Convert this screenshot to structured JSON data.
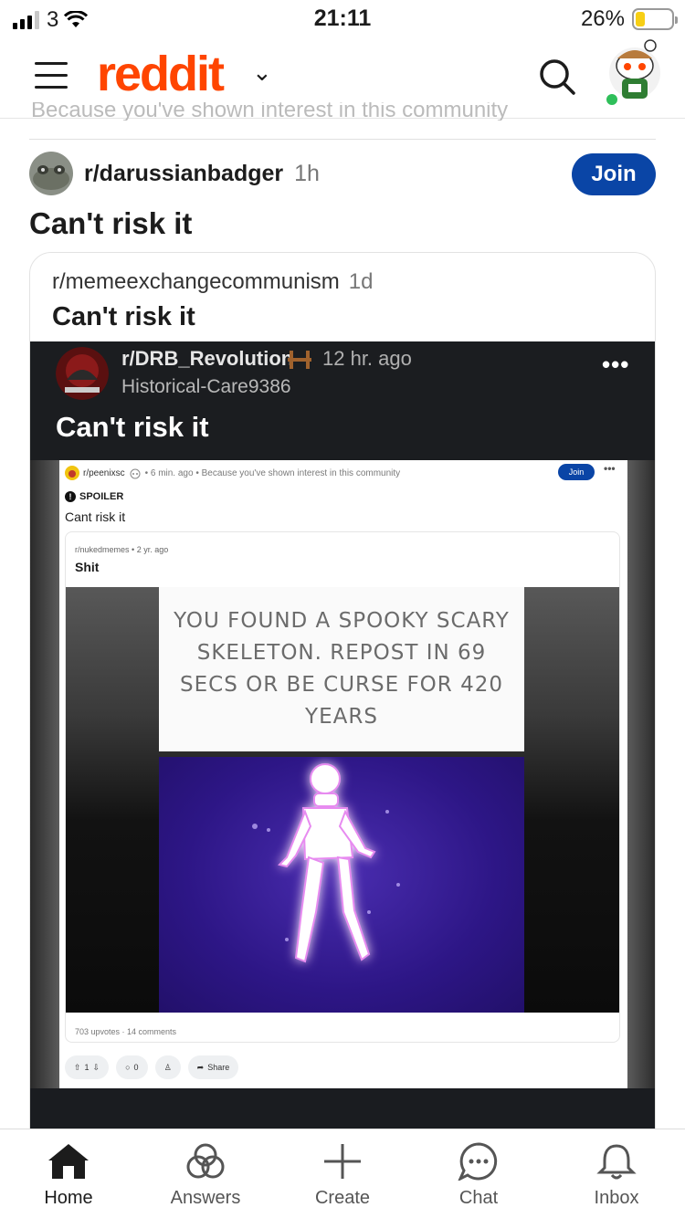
{
  "status_bar": {
    "carrier": "3",
    "time": "21:11",
    "battery_pct": "26%",
    "battery_level": 0.26
  },
  "header": {
    "logo": "reddit",
    "logo_color": "#ff4500"
  },
  "feed_context": {
    "recommendation_text": "Because you've shown interest in this community"
  },
  "post": {
    "subreddit": "r/darussianbadger",
    "age": "1h",
    "join_label": "Join",
    "title": "Can't risk it",
    "crosspost": {
      "subreddit": "r/memeexchangecommunism",
      "age": "1d",
      "title": "Can't risk it",
      "image": {
        "subreddit": "r/DRB_Revolution",
        "time": "12 hr. ago",
        "user": "Historical-Care9386",
        "more": "•••",
        "title": "Can't risk it",
        "inner": {
          "subreddit": "r/peenixsc",
          "meta": "• 6 min. ago • Because you've shown interest in this community",
          "join_label": "Join",
          "more": "•••",
          "spoiler": "SPOILER",
          "title": "Cant risk it",
          "card": {
            "subreddit": "r/nukedmemes",
            "age": "• 2 yr. ago",
            "title": "Shit",
            "meme_text": "YOU FOUND A SPOOKY SCARY SKELETON. REPOST IN 69 SECS OR BE CURSE FOR 420 YEARS",
            "stats": "703 upvotes · 14 comments"
          },
          "actions": {
            "votes": "1",
            "comments": "0",
            "share": "Share"
          }
        }
      }
    }
  },
  "bottom_nav": {
    "home": "Home",
    "answers": "Answers",
    "create": "Create",
    "chat": "Chat",
    "inbox": "Inbox"
  },
  "colors": {
    "join_blue": "#0a45a6",
    "online_green": "#2fbf5a"
  }
}
